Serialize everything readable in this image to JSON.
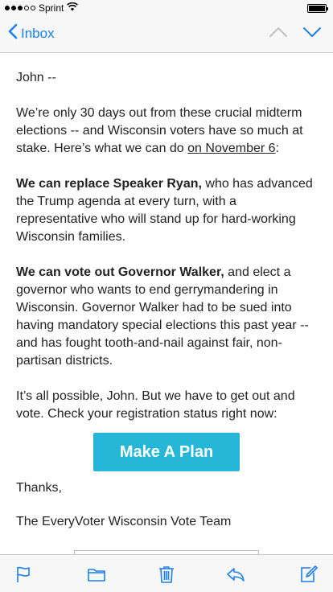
{
  "status_bar": {
    "carrier": "Sprint"
  },
  "nav": {
    "back_label": "Inbox"
  },
  "email": {
    "greeting": "John --",
    "p1_text": "We’re only 30 days out from these crucial midterm elections -- and Wisconsin voters have so much at stake. Here’s what we can do ",
    "p1_link": "on November 6",
    "p1_end": ":",
    "p2_bold": "We can replace Speaker Ryan,",
    "p2_text": " who has advanced the Trump agenda at every turn, with a representative who will stand up for hard-working Wisconsin families.",
    "p3_bold": "We can vote out Governor Walker,",
    "p3_text": " and elect a governor who wants to end gerrymandering in Wisconsin. Governor Walker had to be sued into having mandatory special elections this past year -- and has fought tooth-and-nail against fair, non-partisan districts.",
    "p4_text": "It’s all possible, John. But we have to get out and vote. Check your registration status right now:",
    "cta_label": "Make A Plan",
    "thanks": "Thanks,",
    "signature": "The EveryVoter Wisconsin Vote Team"
  },
  "colors": {
    "accent": "#1a7ff0",
    "cta_bg": "#25b6d8",
    "bar_bg": "#f7f7f7"
  },
  "toolbar_icons": [
    "flag-icon",
    "folder-icon",
    "trash-icon",
    "reply-icon",
    "compose-icon"
  ]
}
